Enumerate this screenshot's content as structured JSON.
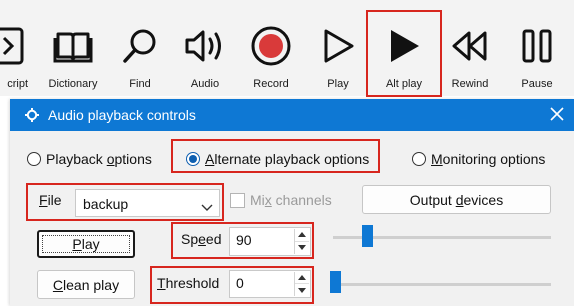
{
  "toolbar": {
    "items": [
      {
        "label": "cript",
        "icon": "script-icon"
      },
      {
        "label": "Dictionary",
        "icon": "book-icon"
      },
      {
        "label": "Find",
        "icon": "magnifier-icon"
      },
      {
        "label": "Audio",
        "icon": "speaker-icon"
      },
      {
        "label": "Record",
        "icon": "record-icon"
      },
      {
        "label": "Play",
        "icon": "play-outline-icon"
      },
      {
        "label": "Alt play",
        "icon": "play-filled-icon"
      },
      {
        "label": "Rewind",
        "icon": "rewind-icon"
      },
      {
        "label": "Pause",
        "icon": "pause-icon"
      }
    ]
  },
  "dialog": {
    "title": "Audio playback controls",
    "title_icon": "gear-icon",
    "close_icon": "close-icon",
    "radios": {
      "playback": {
        "label": "Playback options",
        "selected": false
      },
      "alternate": {
        "label": "Alternate playback options",
        "selected": true
      },
      "monitoring": {
        "label": "Monitoring options",
        "selected": false
      }
    },
    "file_label": "File",
    "file_value": "backup",
    "mix_label": "Mix channels",
    "output_button": "Output devices",
    "play_button": "Play",
    "clean_play_button": "Clean play",
    "speed_label": "Speed",
    "speed_value": "90",
    "threshold_label": "Threshold",
    "threshold_value": "0"
  },
  "colors": {
    "accent": "#0e78d4",
    "record": "#d93a3a",
    "highlight": "#d7261e"
  }
}
